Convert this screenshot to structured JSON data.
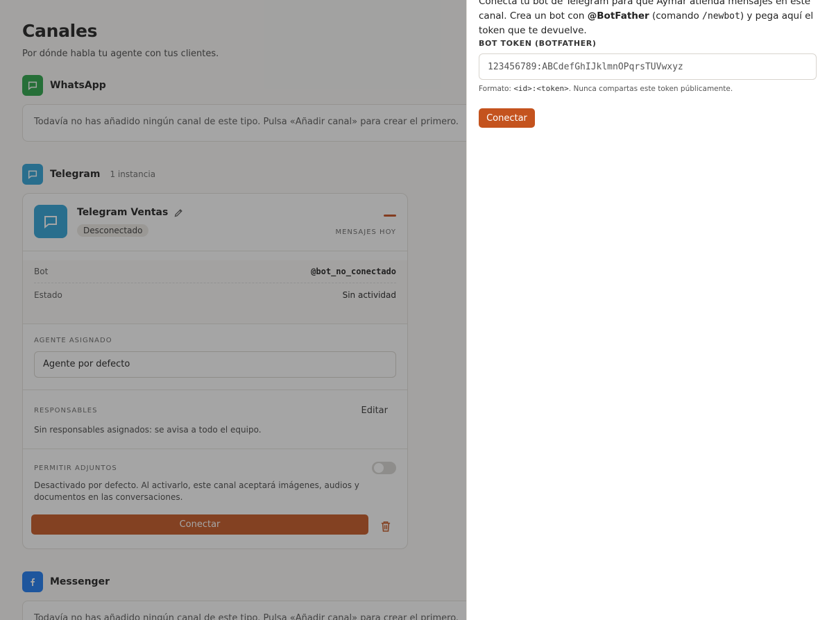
{
  "page": {
    "title": "Canales",
    "subtitle": "Por dónde habla tu agente con tus clientes."
  },
  "whatsapp": {
    "name": "WhatsApp",
    "empty": "Todavía no has añadido ningún canal de este tipo. Pulsa «Añadir canal» para crear el primero."
  },
  "telegram": {
    "name": "Telegram",
    "count": "1 instancia",
    "card": {
      "name": "Telegram Ventas",
      "status": "Desconectado",
      "messages_label": "Mensajes hoy",
      "bot_key": "Bot",
      "bot_value": "@bot_no_conectado",
      "state_key": "Estado",
      "state_value": "Sin actividad",
      "agent_label": "Agente asignado",
      "agent_value": "Agente por defecto",
      "resp_label": "Responsables",
      "resp_edit": "Editar",
      "resp_text": "Sin responsables asignados: se avisa a todo el equipo.",
      "attach_label": "Permitir adjuntos",
      "attach_text": "Desactivado por defecto. Al activarlo, este canal aceptará imágenes, audios y documentos en las conversaciones.",
      "attach_enabled": false,
      "connect_label": "Conectar"
    }
  },
  "messenger": {
    "name": "Messenger",
    "empty": "Todavía no has añadido ningún canal de este tipo. Pulsa «Añadir canal» para crear el primero."
  },
  "drawer": {
    "desc_1": "Conecta tu bot de Telegram para que Aymar atienda mensajes en este canal. Crea un bot con ",
    "desc_bot": "@BotFather",
    "desc_2": " (comando ",
    "desc_cmd": "/newbot",
    "desc_3": ") y pega aquí el token que te devuelve.",
    "field_label": "Bot token (BotFather)",
    "token_placeholder": "123456789:ABCdefGhIJklmnOPqrsTUVwxyz",
    "hint_1": "Formato: ",
    "hint_code": "<id>:<token>",
    "hint_2": ". Nunca compartas este token públicamente.",
    "connect_label": "Conectar"
  },
  "colors": {
    "whatsapp": "#25a244",
    "telegram": "#2aa0d6",
    "messenger": "#1877f2",
    "accent": "#c4531e"
  }
}
